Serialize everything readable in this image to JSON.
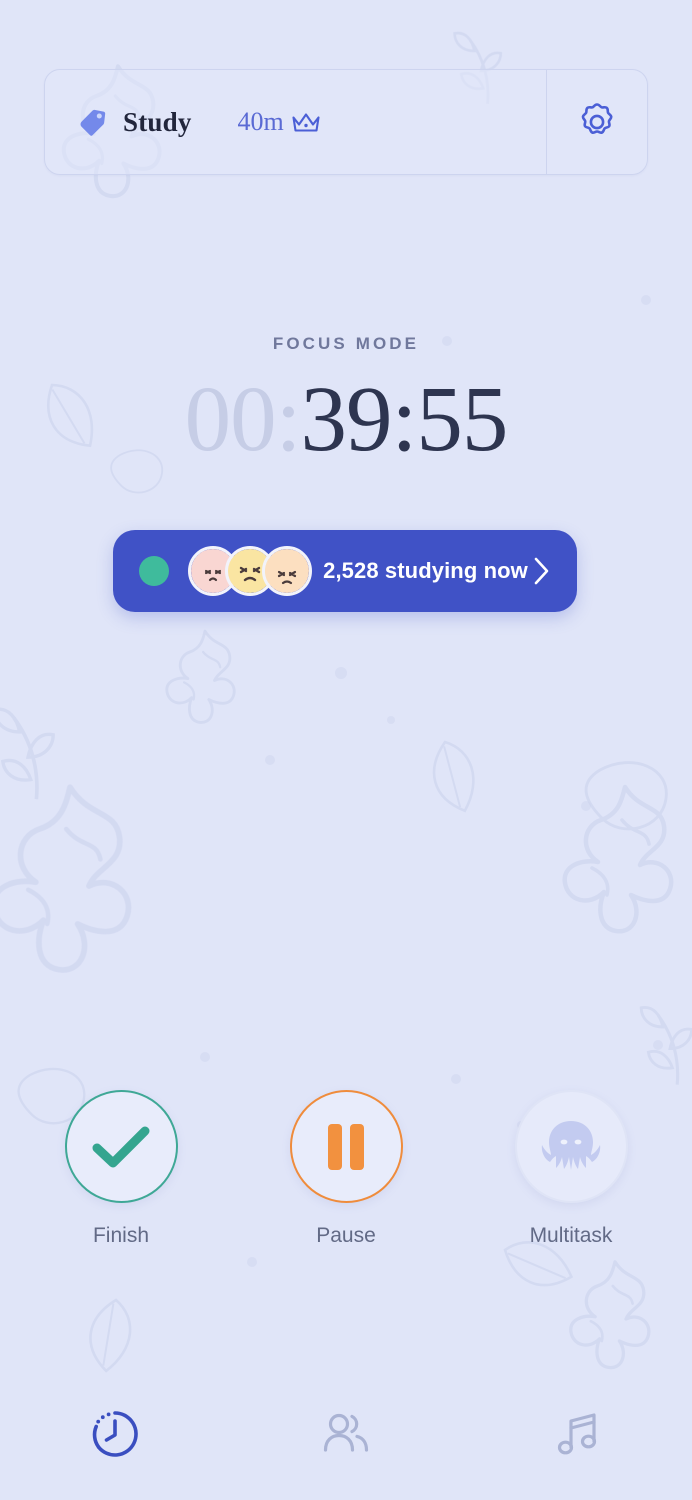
{
  "theme": {
    "background": "#e0e5f8",
    "accent_blue": "#4052c6",
    "accent_green": "#3fbb9c",
    "accent_orange": "#ef8c3c",
    "text_dark": "#2e3550",
    "text_muted": "#70789c"
  },
  "task_card": {
    "tag_icon": "tag-icon",
    "title": "Study",
    "duration": "40m",
    "crown_icon": "crown-icon",
    "settings_icon": "gear-icon"
  },
  "timer": {
    "mode_label": "FOCUS MODE",
    "hours": "00",
    "sep1": ":",
    "minutes": "39",
    "sep2": ":",
    "seconds": "55"
  },
  "live_banner": {
    "status_dot": "live-dot",
    "count_text": "2,528 studying now",
    "chevron_icon": "chevron-right-icon",
    "avatars": [
      {
        "name": "avatar-1",
        "face": "#f6bdb8",
        "bg": "#f9d6d2"
      },
      {
        "name": "avatar-2",
        "face": "#f6d063",
        "bg": "#fae5a2"
      },
      {
        "name": "avatar-3",
        "face": "#fbd0a2",
        "bg": "#fcdfc0"
      }
    ]
  },
  "actions": [
    {
      "id": "finish",
      "label": "Finish",
      "icon": "check-icon"
    },
    {
      "id": "pause",
      "label": "Pause",
      "icon": "pause-icon"
    },
    {
      "id": "multitask",
      "label": "Multitask",
      "icon": "octopus-icon"
    }
  ],
  "bottom_nav": [
    {
      "id": "timer",
      "icon": "clock-icon",
      "active": true
    },
    {
      "id": "social",
      "icon": "people-icon",
      "active": false
    },
    {
      "id": "music",
      "icon": "music-note-icon",
      "active": false
    }
  ]
}
